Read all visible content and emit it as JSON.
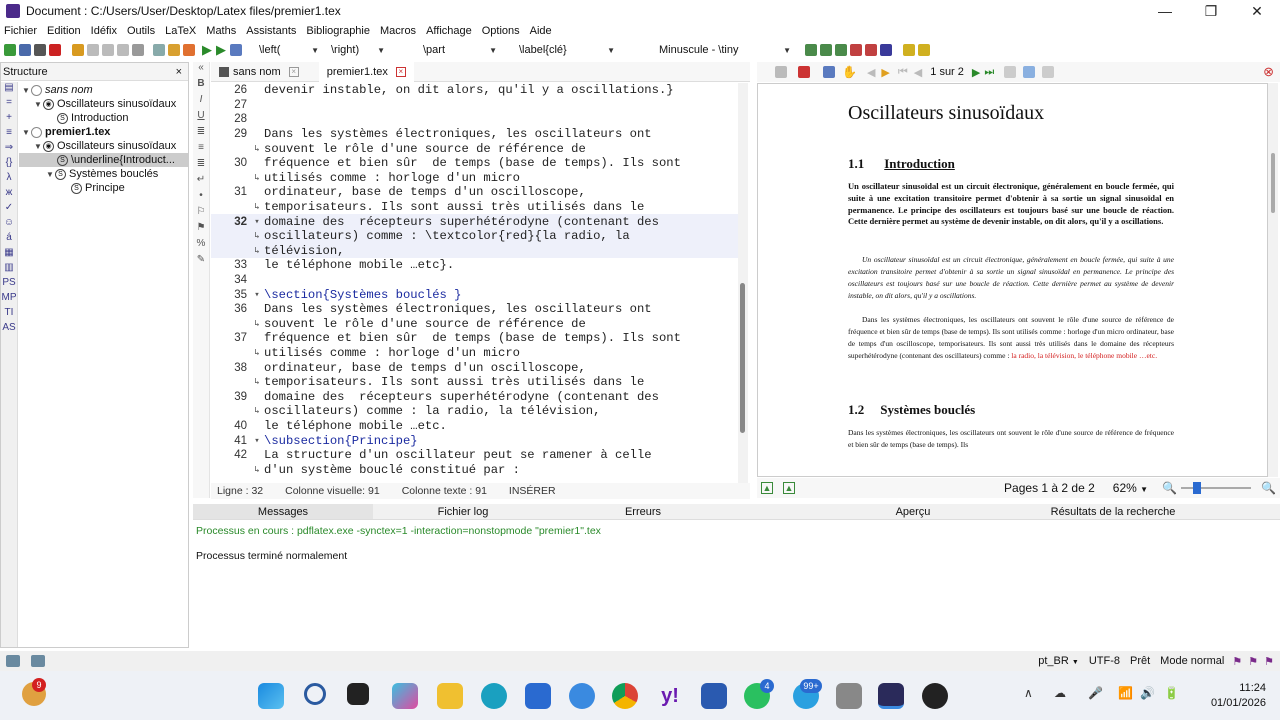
{
  "window": {
    "title": "Document : C:/Users/User/Desktop/Latex files/premier1.tex",
    "controls": [
      "—",
      "❐",
      "✕"
    ]
  },
  "menu": [
    "Fichier",
    "Edition",
    "Idéfix",
    "Outils",
    "LaTeX",
    "Maths",
    "Assistants",
    "Bibliographie",
    "Macros",
    "Affichage",
    "Options",
    "Aide"
  ],
  "toolbar": {
    "left_combo": "\\left(",
    "right_combo": "\\right)",
    "part_combo": "\\part",
    "label_combo": "\\label{clé}",
    "size_combo": "Minuscule - \\tiny"
  },
  "structure": {
    "title": "Structure",
    "close": "×",
    "items": [
      {
        "label": "sans nom",
        "level": 0,
        "italic": true
      },
      {
        "label": "Oscillateurs sinusoïdaux",
        "level": 1
      },
      {
        "label": "Introduction",
        "level": 2
      },
      {
        "label": "premier1.tex",
        "level": 0,
        "bold": true
      },
      {
        "label": "Oscillateurs sinusoïdaux",
        "level": 1
      },
      {
        "label": "\\underline{Introduct...",
        "level": 2
      },
      {
        "label": "Systèmes bouclés",
        "level": 1
      },
      {
        "label": "Principe",
        "level": 2
      }
    ]
  },
  "tabs": [
    {
      "label": "sans nom"
    },
    {
      "label": "premier1.tex"
    }
  ],
  "editor": {
    "lines": [
      {
        "n": "26",
        "text": "devenir instable, on dit alors, qu'il y a oscillations.}"
      },
      {
        "n": "27",
        "text": ""
      },
      {
        "n": "28",
        "text": ""
      },
      {
        "n": "29",
        "text": "Dans les systèmes électroniques, les oscillateurs ont"
      },
      {
        "n": "",
        "text": "souvent le rôle d'une source de référence de"
      },
      {
        "n": "30",
        "text": "fréquence et bien sûr  de temps (base de temps). Ils sont"
      },
      {
        "n": "",
        "text": "utilisés comme : horloge d'un micro"
      },
      {
        "n": "31",
        "text": "ordinateur, base de temps d'un oscilloscope,"
      },
      {
        "n": "",
        "text": "temporisateurs. Ils sont aussi très utilisés dans le"
      },
      {
        "n": "32",
        "text": "domaine des  récepteurs superhétérodyne (contenant des"
      },
      {
        "n": "",
        "text": "oscillateurs) comme : \\textcolor{red}{la radio, la"
      },
      {
        "n": "",
        "text": "télévision,"
      },
      {
        "n": "33",
        "text": "le téléphone mobile …etc}."
      },
      {
        "n": "34",
        "text": ""
      },
      {
        "n": "35",
        "text": "\\section{Systèmes bouclés }"
      },
      {
        "n": "36",
        "text": "Dans les systèmes électroniques, les oscillateurs ont"
      },
      {
        "n": "",
        "text": "souvent le rôle d'une source de référence de"
      },
      {
        "n": "37",
        "text": "fréquence et bien sûr  de temps (base de temps). Ils sont"
      },
      {
        "n": "",
        "text": "utilisés comme : horloge d'un micro"
      },
      {
        "n": "38",
        "text": "ordinateur, base de temps d'un oscilloscope,"
      },
      {
        "n": "",
        "text": "temporisateurs. Ils sont aussi très utilisés dans le"
      },
      {
        "n": "39",
        "text": "domaine des  récepteurs superhétérodyne (contenant des"
      },
      {
        "n": "",
        "text": "oscillateurs) comme : la radio, la télévision,"
      },
      {
        "n": "40",
        "text": "le téléphone mobile …etc."
      },
      {
        "n": "41",
        "text": "\\subsection{Principe}"
      },
      {
        "n": "42",
        "text": "La structure d'un oscillateur peut se ramener à celle"
      },
      {
        "n": "",
        "text": "d'un système bouclé constitué par :"
      }
    ],
    "status": {
      "line": "Ligne : 32",
      "col_visual": "Colonne visuelle: 91",
      "col_text": "Colonne texte : 91",
      "mode": "INSÉRER"
    }
  },
  "preview": {
    "page_indicator": "1 sur 2",
    "title": "Oscillateurs sinusoïdaux",
    "s1_num": "1.1",
    "s1_title": "Introduction",
    "bold_para": "Un oscillateur sinusoïdal est un circuit électronique, généralement en boucle fermée, qui suite à une excitation transitoire permet d'obtenir à sa sortie un signal sinusoïdal en permanence. Le principe des oscillateurs est toujours basé sur une boucle de réaction. Cette dernière permet au système de devenir instable, on dit alors, qu'il y a oscillations.",
    "italic_para": "Un oscillateur sinusoïdal est un circuit électronique, généralement en boucle fermée, qui suite à une excitation transitoire permet d'obtenir à sa sortie un signal sinusoïdal en permanence. Le principe des oscillateurs est toujours basé sur une boucle de réaction. Cette dernière permet au système de devenir instable, on dit alors, qu'il y a oscillations.",
    "normal_para": "Dans les systèmes électroniques, les oscillateurs ont souvent le rôle d'une source de référence de fréquence et bien sûr de temps (base de temps). Ils sont utilisés comme : horloge d'un micro ordinateur, base de temps d'un oscilloscope, temporisateurs. Ils sont aussi très utilisés dans le domaine des récepteurs superhétérodyne (contenant des oscillateurs) comme :",
    "red_text": "la radio, la télévision, le téléphone mobile …etc.",
    "s2_num": "1.2",
    "s2_title": "Systèmes bouclés",
    "s2_para": "Dans les systèmes électroniques, les oscillateurs ont souvent le rôle d'une source de référence de fréquence et bien sûr de temps (base de temps). Ils",
    "pages_label": "Pages 1 à 2 de 2",
    "zoom": "62%",
    "zoom_level": 0.2
  },
  "messages": {
    "tabs": [
      "Messages",
      "Fichier log",
      "Erreurs",
      "Aperçu",
      "Résultats de la recherche"
    ],
    "process_line": "Processus en cours : pdflatex.exe  -synctex=1  -interaction=nonstopmode \"premier1\".tex",
    "done_line": "Processus terminé normalement"
  },
  "statusbar": {
    "lang": "pt_BR",
    "encoding": "UTF-8",
    "state": "Prêt",
    "mode": "Mode normal"
  },
  "taskbar": {
    "time": "11:24",
    "date": "01/01/2026",
    "weather_badge": "9",
    "whatsapp_badge": "4",
    "telegram_badge": "99+"
  },
  "colors": {
    "accent": "#1a2aa0",
    "red": "#d32020",
    "window_bg": "#f0f0f0"
  }
}
